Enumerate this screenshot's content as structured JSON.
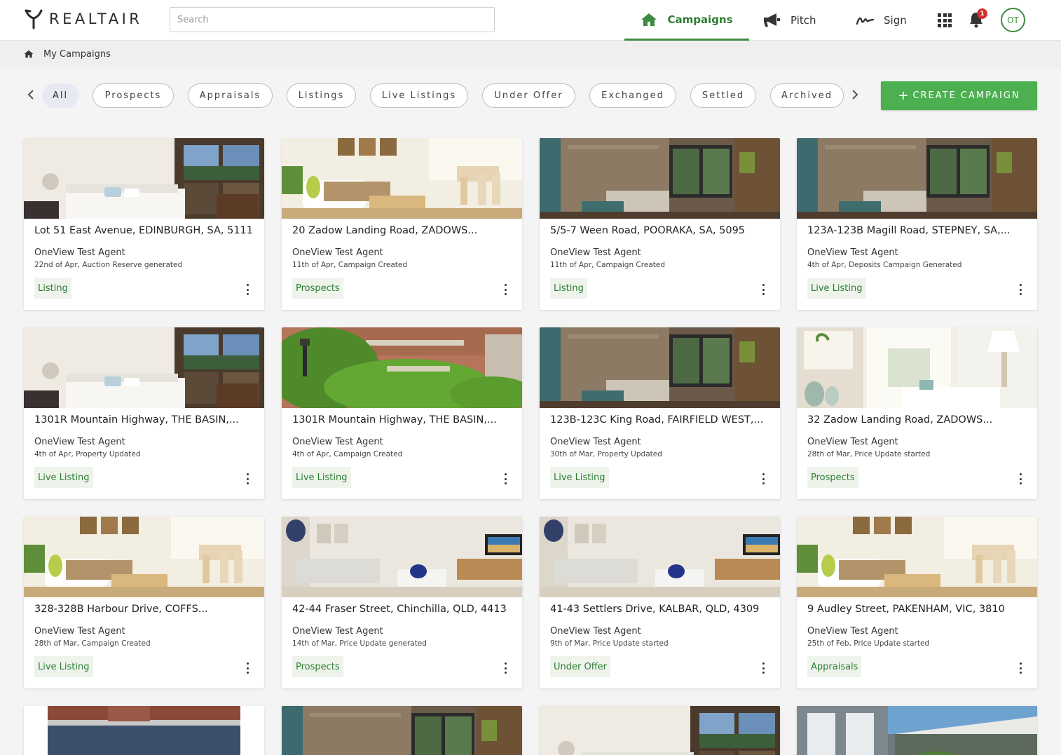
{
  "app": {
    "logo_text": "REALTAIR"
  },
  "search": {
    "placeholder": "Search"
  },
  "nav": [
    {
      "label": "Campaigns",
      "icon": "home-icon",
      "active": true
    },
    {
      "label": "Pitch",
      "icon": "megaphone-icon"
    },
    {
      "label": "Sign",
      "icon": "signature-icon"
    }
  ],
  "notifications": {
    "count": "1"
  },
  "user": {
    "initials": "OT"
  },
  "breadcrumb": {
    "label": "My Campaigns"
  },
  "filters": {
    "chips": [
      "All",
      "Prospects",
      "Appraisals",
      "Listings",
      "Live Listings",
      "Under Offer",
      "Exchanged",
      "Settled",
      "Archived"
    ],
    "active": "All"
  },
  "create_button": {
    "label": "CREATE CAMPAIGN"
  },
  "colors": {
    "accent": "#4caf50",
    "accent_dark": "#2e7d32",
    "tag_bg": "#eef4ec",
    "badge": "#d32f2f"
  },
  "campaigns": [
    {
      "title": "Lot 51 East Avenue, EDINBURGH, SA, 5111",
      "agent": "OneView Test Agent",
      "event": "22nd of Apr, Auction Reserve generated",
      "status": "Listing",
      "image": "bedroom"
    },
    {
      "title": "20 Zadow Landing Road, ZADOWS...",
      "agent": "OneView Test Agent",
      "event": "11th of Apr, Campaign Created",
      "status": "Prospects",
      "image": "dining"
    },
    {
      "title": "5/5-7 Ween Road, POORAKA, SA, 5095",
      "agent": "OneView Test Agent",
      "event": "11th of Apr, Campaign Created",
      "status": "Listing",
      "image": "living-dark"
    },
    {
      "title": "123A-123B Magill Road, STEPNEY, SA,...",
      "agent": "OneView Test Agent",
      "event": "4th of Apr, Deposits Campaign Generated",
      "status": "Live Listing",
      "image": "living-dark"
    },
    {
      "title": "1301R Mountain Highway, THE BASIN,...",
      "agent": "OneView Test Agent",
      "event": "4th of Apr, Property Updated",
      "status": "Live Listing",
      "image": "bedroom"
    },
    {
      "title": "1301R Mountain Highway, THE BASIN,...",
      "agent": "OneView Test Agent",
      "event": "4th of Apr, Campaign Created",
      "status": "Live Listing",
      "image": "garden"
    },
    {
      "title": "123B-123C King Road, FAIRFIELD WEST,...",
      "agent": "OneView Test Agent",
      "event": "30th of Mar, Property Updated",
      "status": "Live Listing",
      "image": "living-dark"
    },
    {
      "title": "32 Zadow Landing Road, ZADOWS...",
      "agent": "OneView Test Agent",
      "event": "28th of Mar, Price Update started",
      "status": "Prospects",
      "image": "living-bright"
    },
    {
      "title": "328-328B Harbour Drive, COFFS...",
      "agent": "OneView Test Agent",
      "event": "28th of Mar, Campaign Created",
      "status": "Live Listing",
      "image": "dining"
    },
    {
      "title": "42-44 Fraser Street, Chinchilla, QLD, 4413",
      "agent": "OneView Test Agent",
      "event": "14th of Mar, Price Update generated",
      "status": "Prospects",
      "image": "lounge"
    },
    {
      "title": "41-43 Settlers Drive, KALBAR, QLD, 4309",
      "agent": "OneView Test Agent",
      "event": "9th of Mar, Price Update started",
      "status": "Under Offer",
      "image": "lounge"
    },
    {
      "title": "9 Audley Street, PAKENHAM, VIC, 3810",
      "agent": "OneView Test Agent",
      "event": "25th of Feb, Price Update started",
      "status": "Appraisals",
      "image": "dining"
    }
  ],
  "partial_cards": [
    {
      "image": "brick-house"
    },
    {
      "image": "living-dark"
    },
    {
      "image": "bedroom"
    },
    {
      "image": "weatherboard"
    }
  ]
}
